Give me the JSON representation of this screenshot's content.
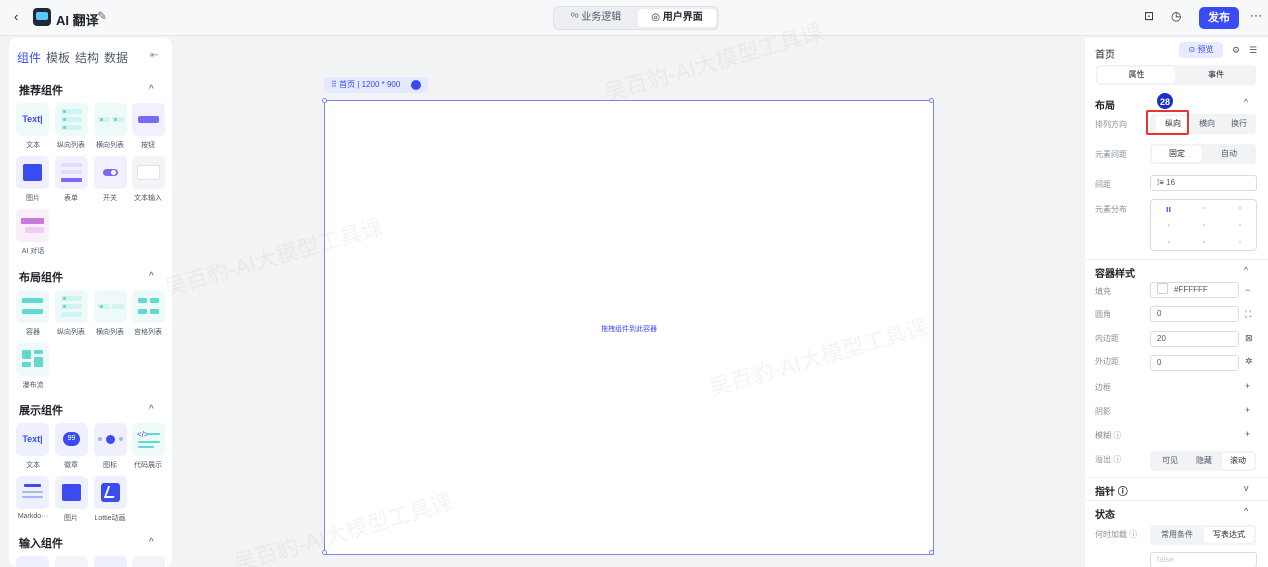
{
  "topbar": {
    "back": "‹",
    "title": "AI 翻译",
    "edit": "✎",
    "seg_logic": "⁰ᵒ 业务逻辑",
    "seg_ui": "◎ 用户界面",
    "publish": "发布",
    "more": "···"
  },
  "left": {
    "tabs": [
      "组件",
      "模板",
      "结构",
      "数据"
    ],
    "collapse": "⇤",
    "sections": {
      "recommended": "推荐组件",
      "layout": "布局组件",
      "display": "展示组件",
      "input": "输入组件"
    },
    "chevron_up": "^",
    "recommended": [
      "文本",
      "纵向列表",
      "横向列表",
      "按钮",
      "图片",
      "表单",
      "开关",
      "文本输入",
      "AI 对话"
    ],
    "layout": [
      "容器",
      "纵向列表",
      "横向列表",
      "宫格列表",
      "瀑布流"
    ],
    "display": [
      "文本",
      "徽章",
      "图标",
      "代码展示",
      "Markdo···",
      "图片",
      "Lottie动画"
    ],
    "text_glyph": "Text|",
    "badge_glyph": "99",
    "code_glyph": "</>"
  },
  "canvas": {
    "label": "⠿ 首页 | 1200 * 900",
    "hint": "拖拽组件到此容器"
  },
  "right": {
    "page_title": "首页",
    "preview": "⊙ 预览",
    "tab_attr": "属性",
    "tab_event": "事件",
    "layout_section": "布局",
    "badge_number": "28",
    "arrange_label": "排列方向",
    "arrange": [
      "纵向",
      "横向",
      "换行"
    ],
    "spacing_mode_label": "元素间距",
    "spacing_mode": [
      "固定",
      "自动"
    ],
    "gap_label": "间距",
    "gap_value": "16",
    "distribution_label": "元素分布",
    "container_section": "容器样式",
    "fill_label": "填充",
    "fill_value": "#FFFFFF",
    "radius_label": "圆角",
    "radius_value": "0",
    "padding_label": "内边距",
    "padding_value": "20",
    "margin_label": "外边距",
    "margin_value": "0",
    "border_label": "边框",
    "shadow_label": "阴影",
    "blur_label": "模糊 ⓘ",
    "overflow_label": "溢出 ⓘ",
    "overflow": [
      "可见",
      "隐藏",
      "滚动"
    ],
    "pointer_section": "指针 ⓘ",
    "state_section": "状态",
    "load_label": "何时加载 ⓘ",
    "load_options": [
      "常用条件",
      "写表达式"
    ],
    "load_value_placeholder": "false",
    "plus": "+",
    "minus": "−"
  },
  "watermark": "吴百豹-AI大模型工具课",
  "colors": {
    "accent": "#3a4bf2",
    "highlight": "#e23636",
    "badge": "#1a2fc9"
  }
}
